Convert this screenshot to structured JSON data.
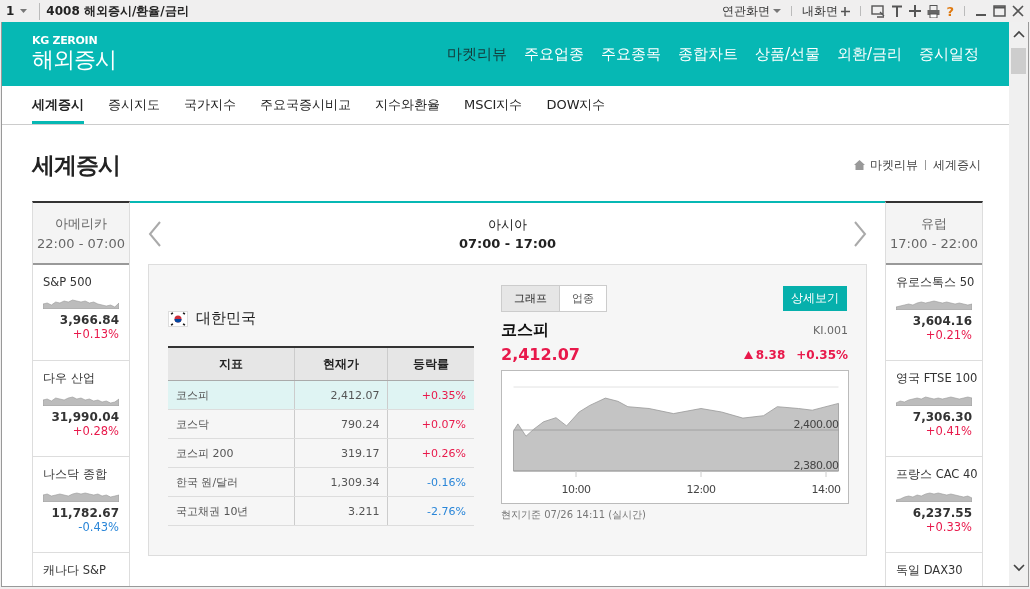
{
  "window": {
    "number": "1",
    "title": "4008 해외증시/환율/금리",
    "links": [
      {
        "label": "연관화면",
        "kind": "dropdown"
      },
      {
        "label": "내화면",
        "kind": "add"
      }
    ],
    "help": "?"
  },
  "header": {
    "brand_top": "KG ZEROIN",
    "brand": "해외증시",
    "nav": [
      {
        "label": "마켓리뷰",
        "selected": true
      },
      {
        "label": "주요업종",
        "selected": false
      },
      {
        "label": "주요종목",
        "selected": false
      },
      {
        "label": "종합차트",
        "selected": false
      },
      {
        "label": "상품/선물",
        "selected": false
      },
      {
        "label": "외환/금리",
        "selected": false
      },
      {
        "label": "증시일정",
        "selected": false
      }
    ]
  },
  "subnav": [
    {
      "label": "세계증시",
      "selected": true
    },
    {
      "label": "증시지도",
      "selected": false
    },
    {
      "label": "국가지수",
      "selected": false
    },
    {
      "label": "주요국증시비교",
      "selected": false
    },
    {
      "label": "지수와환율",
      "selected": false
    },
    {
      "label": "MSCI지수",
      "selected": false
    },
    {
      "label": "DOW지수",
      "selected": false
    }
  ],
  "page": {
    "title": "세계증시",
    "breadcrumb": [
      "마켓리뷰",
      "세계증시"
    ]
  },
  "left_region": {
    "name": "아메리카",
    "hours": "22:00 - 07:00",
    "items": [
      {
        "name": "S&P 500",
        "value": "3,966.84",
        "change": "+0.13%",
        "color": "#e8194b"
      },
      {
        "name": "다우 산업",
        "value": "31,990.04",
        "change": "+0.28%",
        "color": "#e8194b"
      },
      {
        "name": "나스닥 종합",
        "value": "11,782.67",
        "change": "-0.43%",
        "color": "#2a86d8"
      },
      {
        "name": "캐나다 S&P"
      }
    ]
  },
  "center_region": {
    "name": "아시아",
    "hours": "07:00 - 17:00"
  },
  "right_region": {
    "name": "유럽",
    "hours": "17:00 - 22:00",
    "items": [
      {
        "name": "유로스톡스 50",
        "value": "3,604.16",
        "change": "+0.21%",
        "color": "#e8194b"
      },
      {
        "name": "영국 FTSE 100",
        "value": "7,306.30",
        "change": "+0.41%",
        "color": "#e8194b"
      },
      {
        "name": "프랑스 CAC 40",
        "value": "6,237.55",
        "change": "+0.33%",
        "color": "#e8194b"
      },
      {
        "name": "독일 DAX30"
      }
    ]
  },
  "country": {
    "name": "대한민국",
    "table": {
      "columns": [
        "지표",
        "현재가",
        "등락률"
      ],
      "rows": [
        {
          "cells": [
            "코스피",
            "2,412.07",
            "+0.35%"
          ],
          "color": "#e8194b",
          "selected": true
        },
        {
          "cells": [
            "코스닥",
            "790.24",
            "+0.07%"
          ],
          "color": "#e8194b",
          "selected": false
        },
        {
          "cells": [
            "코스피 200",
            "319.17",
            "+0.26%"
          ],
          "color": "#e8194b",
          "selected": false
        },
        {
          "cells": [
            "한국 원/달러",
            "1,309.34",
            "-0.16%"
          ],
          "color": "#2a86d8",
          "selected": false
        },
        {
          "cells": [
            "국고채권 10년",
            "3.211",
            "-2.76%"
          ],
          "color": "#2a86d8",
          "selected": false
        }
      ]
    }
  },
  "detail": {
    "tabs": [
      {
        "label": "그래프",
        "selected": true
      },
      {
        "label": "업종",
        "selected": false
      }
    ],
    "button": "상세보기",
    "index_name": "코스피",
    "code": "KI.001",
    "price": "2,412.07",
    "change": "8.38",
    "change_rate": "+0.35%",
    "color": "#e8194b",
    "kind": "up",
    "chart_data": {
      "type": "area",
      "x": [
        9.0,
        9.07,
        9.2,
        9.32,
        9.48,
        9.68,
        9.85,
        10.05,
        10.22,
        10.47,
        10.67,
        10.83,
        11.17,
        11.56,
        12.0,
        12.33,
        12.67,
        13.0,
        13.22,
        13.56,
        13.78,
        14.2
      ],
      "series": [
        {
          "color": "#c4c4c4",
          "values": [
            2399.5,
            2403,
            2397,
            2400.3,
            2404,
            2406,
            2402,
            2408.8,
            2412,
            2415.6,
            2414,
            2411.4,
            2410.5,
            2408,
            2410.5,
            2408.8,
            2405.8,
            2407,
            2411.4,
            2410.5,
            2409.7,
            2413
          ]
        }
      ],
      "xlim": [
        9.0,
        14.2
      ],
      "ylim": [
        2380,
        2421
      ],
      "xticks": [
        {
          "value": 10,
          "label": "10:00"
        },
        {
          "value": 12,
          "label": "12:00"
        },
        {
          "value": 14,
          "label": "14:00"
        }
      ],
      "yticks": [
        {
          "value": 2380,
          "label": "2,380.00"
        },
        {
          "value": 2400,
          "label": "2,400.00"
        }
      ]
    },
    "timestamp": "현지기준 07/26 14:11 (실시간)"
  }
}
